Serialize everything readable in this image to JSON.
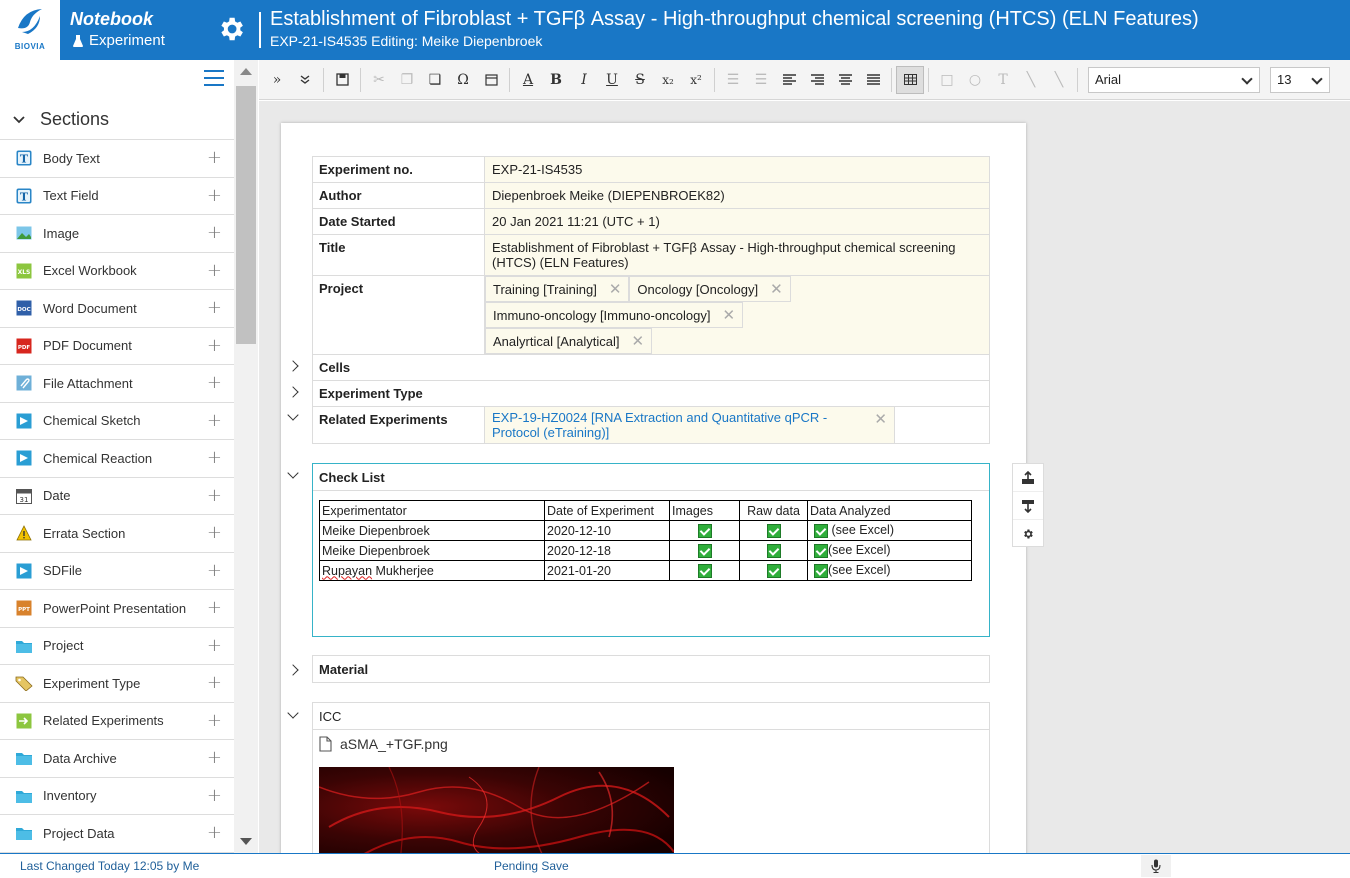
{
  "header": {
    "logo_text": "BIOVIA",
    "app_name": "Notebook",
    "app_sub": "Experiment",
    "title": "Establishment of Fibroblast + TGFβ Assay - High-throughput chemical screening (HTCS) (ELN Features)",
    "subtitle": "EXP-21-IS4535 Editing: Meike Diepenbroek",
    "brand_color": "#1977c6"
  },
  "sidebar": {
    "heading": "Sections",
    "items": [
      {
        "label": "Body Text",
        "icon": "text-t-icon"
      },
      {
        "label": "Text Field",
        "icon": "text-t-icon"
      },
      {
        "label": "Image",
        "icon": "image-icon"
      },
      {
        "label": "Excel Workbook",
        "icon": "xls-icon"
      },
      {
        "label": "Word Document",
        "icon": "doc-icon"
      },
      {
        "label": "PDF Document",
        "icon": "pdf-icon"
      },
      {
        "label": "File Attachment",
        "icon": "paperclip-icon"
      },
      {
        "label": "Chemical Sketch",
        "icon": "chem-icon"
      },
      {
        "label": "Chemical Reaction",
        "icon": "chem-icon"
      },
      {
        "label": "Date",
        "icon": "calendar-icon"
      },
      {
        "label": "Errata Section",
        "icon": "warning-icon"
      },
      {
        "label": "SDFile",
        "icon": "chem-icon"
      },
      {
        "label": "PowerPoint Presentation",
        "icon": "ppt-icon"
      },
      {
        "label": "Project",
        "icon": "folder-icon"
      },
      {
        "label": "Experiment Type",
        "icon": "tag-icon"
      },
      {
        "label": "Related Experiments",
        "icon": "related-icon"
      },
      {
        "label": "Data Archive",
        "icon": "folder-icon"
      },
      {
        "label": "Inventory",
        "icon": "folder-icon"
      },
      {
        "label": "Project Data",
        "icon": "folder-icon"
      }
    ]
  },
  "toolbar": {
    "font": "Arial",
    "size": "13"
  },
  "meta": {
    "experiment_no_label": "Experiment no.",
    "experiment_no": "EXP-21-IS4535",
    "author_label": "Author",
    "author": "Diepenbroek Meike (DIEPENBROEK82)",
    "date_label": "Date Started",
    "date": "20 Jan 2021 11:21 (UTC + 1)",
    "title_label": "Title",
    "title": "Establishment of  Fibroblast + TGFβ Assay - High-throughput chemical screening (HTCS) (ELN Features)",
    "project_label": "Project",
    "projects": [
      "Training [Training]",
      "Oncology [Oncology]",
      "Immuno-oncology [Immuno-oncology]",
      "Analyrtical [Analytical]"
    ],
    "cells_label": "Cells",
    "exp_type_label": "Experiment Type",
    "related_label": "Related Experiments",
    "related": "EXP-19-HZ0024 [RNA Extraction and Quantitative qPCR - Protocol (eTraining)]"
  },
  "checklist": {
    "title": "Check List",
    "headers": [
      "Experimentator",
      "Date of Experiment",
      "Images",
      "Raw data",
      "Data Analyzed"
    ],
    "rows": [
      {
        "name": "Meike Diepenbroek",
        "date": "2020-12-10",
        "note": " (see Excel)"
      },
      {
        "name": "Meike Diepenbroek",
        "date": "2020-12-18",
        "note": "(see Excel)"
      },
      {
        "name_a": "Rupayan",
        "name_b": " Mukherjee",
        "date": "2021-01-20",
        "note": "(see Excel)"
      }
    ]
  },
  "material": {
    "title": "Material"
  },
  "icc": {
    "title": "ICC",
    "file": "aSMA_+TGF.png"
  },
  "status": {
    "last_changed": "Last Changed Today 12:05 by Me",
    "pending": "Pending Save"
  }
}
